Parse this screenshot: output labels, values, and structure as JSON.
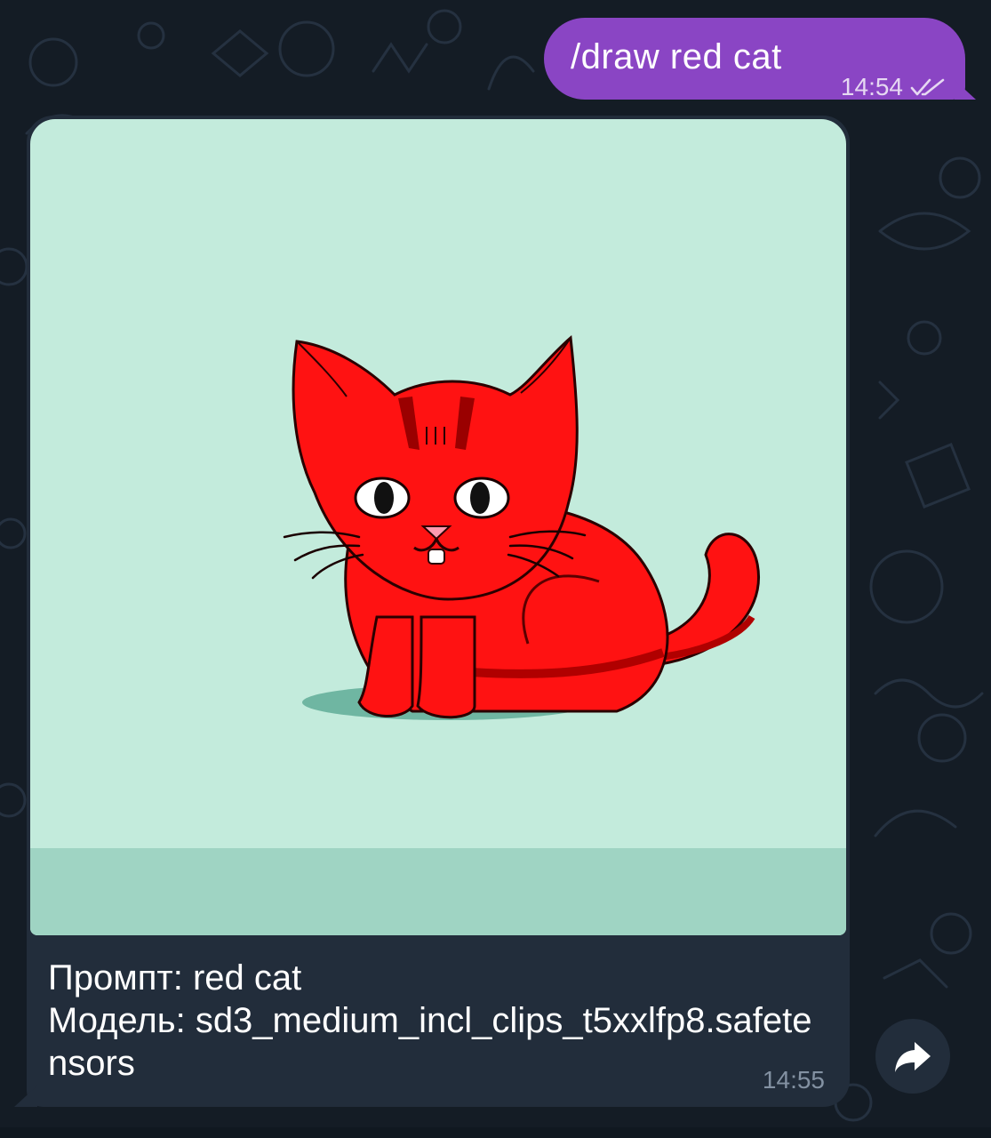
{
  "messages": {
    "outgoing": {
      "text": "/draw red cat",
      "time": "14:54",
      "status_icon": "double-check-icon"
    },
    "incoming": {
      "image_alt_icon": "generated-image",
      "caption_prompt_label": "Промпт:",
      "caption_prompt_value": "red cat",
      "caption_model_label": "Модель:",
      "caption_model_value": "sd3_medium_incl_clips_t5xxlfp8.safetensors",
      "time": "14:55"
    }
  },
  "actions": {
    "forward_icon": "forward-arrow-icon"
  },
  "colors": {
    "background": "#141c25",
    "outgoing_bubble": "#8a45c4",
    "incoming_bubble": "#222d3b",
    "image_background": "#c3ebdc",
    "cat": "#ff1212"
  }
}
